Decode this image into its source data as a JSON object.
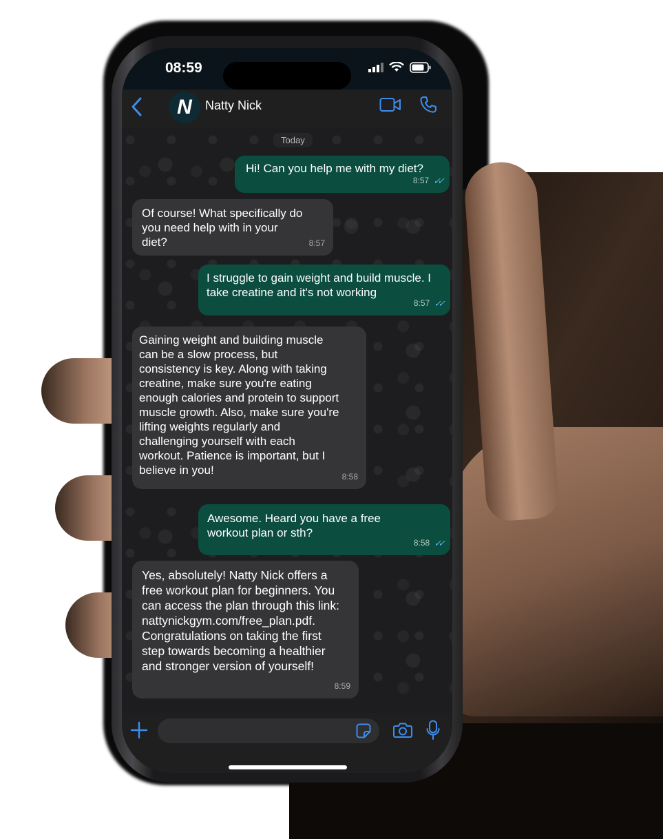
{
  "status_bar": {
    "time": "08:59"
  },
  "header": {
    "contact_name": "Natty Nick",
    "avatar_letter": "N"
  },
  "date_separator": "Today",
  "messages": [
    {
      "direction": "outgoing",
      "text": "Hi! Can you help me with my diet?",
      "time": "8:57",
      "read": true
    },
    {
      "direction": "incoming",
      "text": "Of course! What specifically do you need help with in your diet?",
      "time": "8:57"
    },
    {
      "direction": "outgoing",
      "text": "I struggle to gain weight and build muscle. I take creatine and it's not working",
      "time": "8:57",
      "read": true
    },
    {
      "direction": "incoming",
      "text": "Gaining weight and building muscle can be a slow process, but consistency is key. Along with taking creatine, make sure you're eating enough calories and protein to support muscle growth. Also, make sure you're lifting weights regularly and challenging yourself with each workout. Patience is important, but I believe in you!",
      "time": "8:58"
    },
    {
      "direction": "outgoing",
      "text": "Awesome. Heard you have a free workout plan or sth?",
      "time": "8:58",
      "read": true
    },
    {
      "direction": "incoming",
      "text": "Yes, absolutely! Natty Nick offers a free workout plan for beginners. You can access the plan through this link: nattynickgym.com/free_plan.pdf. Congratulations on taking the first step towards becoming a healthier and stronger version of yourself!",
      "time": "8:59"
    }
  ],
  "colors": {
    "accent": "#3b8ef0",
    "outgoing_bubble": "#0b4d3f",
    "incoming_bubble": "#353537",
    "read_ticks": "#53bdeb"
  },
  "icons": {
    "back": "chevron-left-icon",
    "video": "video-camera-icon",
    "call": "phone-icon",
    "attach": "plus-icon",
    "sticker": "sticker-icon",
    "camera": "camera-icon",
    "mic": "microphone-icon"
  }
}
